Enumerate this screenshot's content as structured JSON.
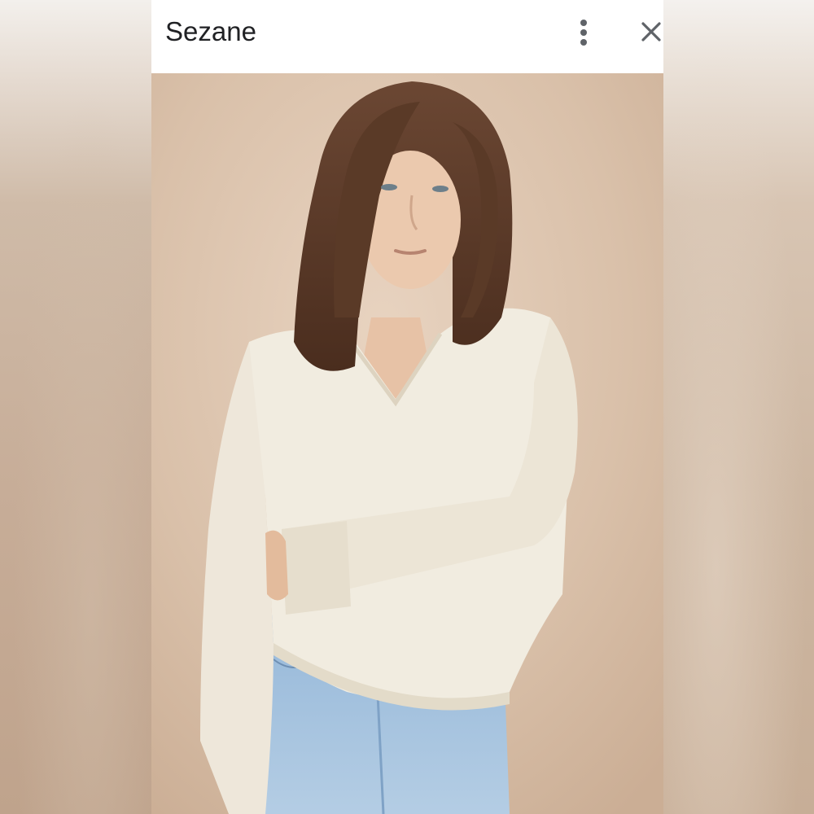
{
  "viewer": {
    "title": "Sezane",
    "actions": {
      "more": "more-options-icon",
      "close": "close-icon"
    }
  },
  "image": {
    "subject": "photo",
    "colors": {
      "background": "#d8bfa8",
      "sweater": "#f1ece0",
      "hair": "#5a3a27",
      "jeans": "#a9c4de",
      "skin": "#e9c7ad"
    }
  }
}
